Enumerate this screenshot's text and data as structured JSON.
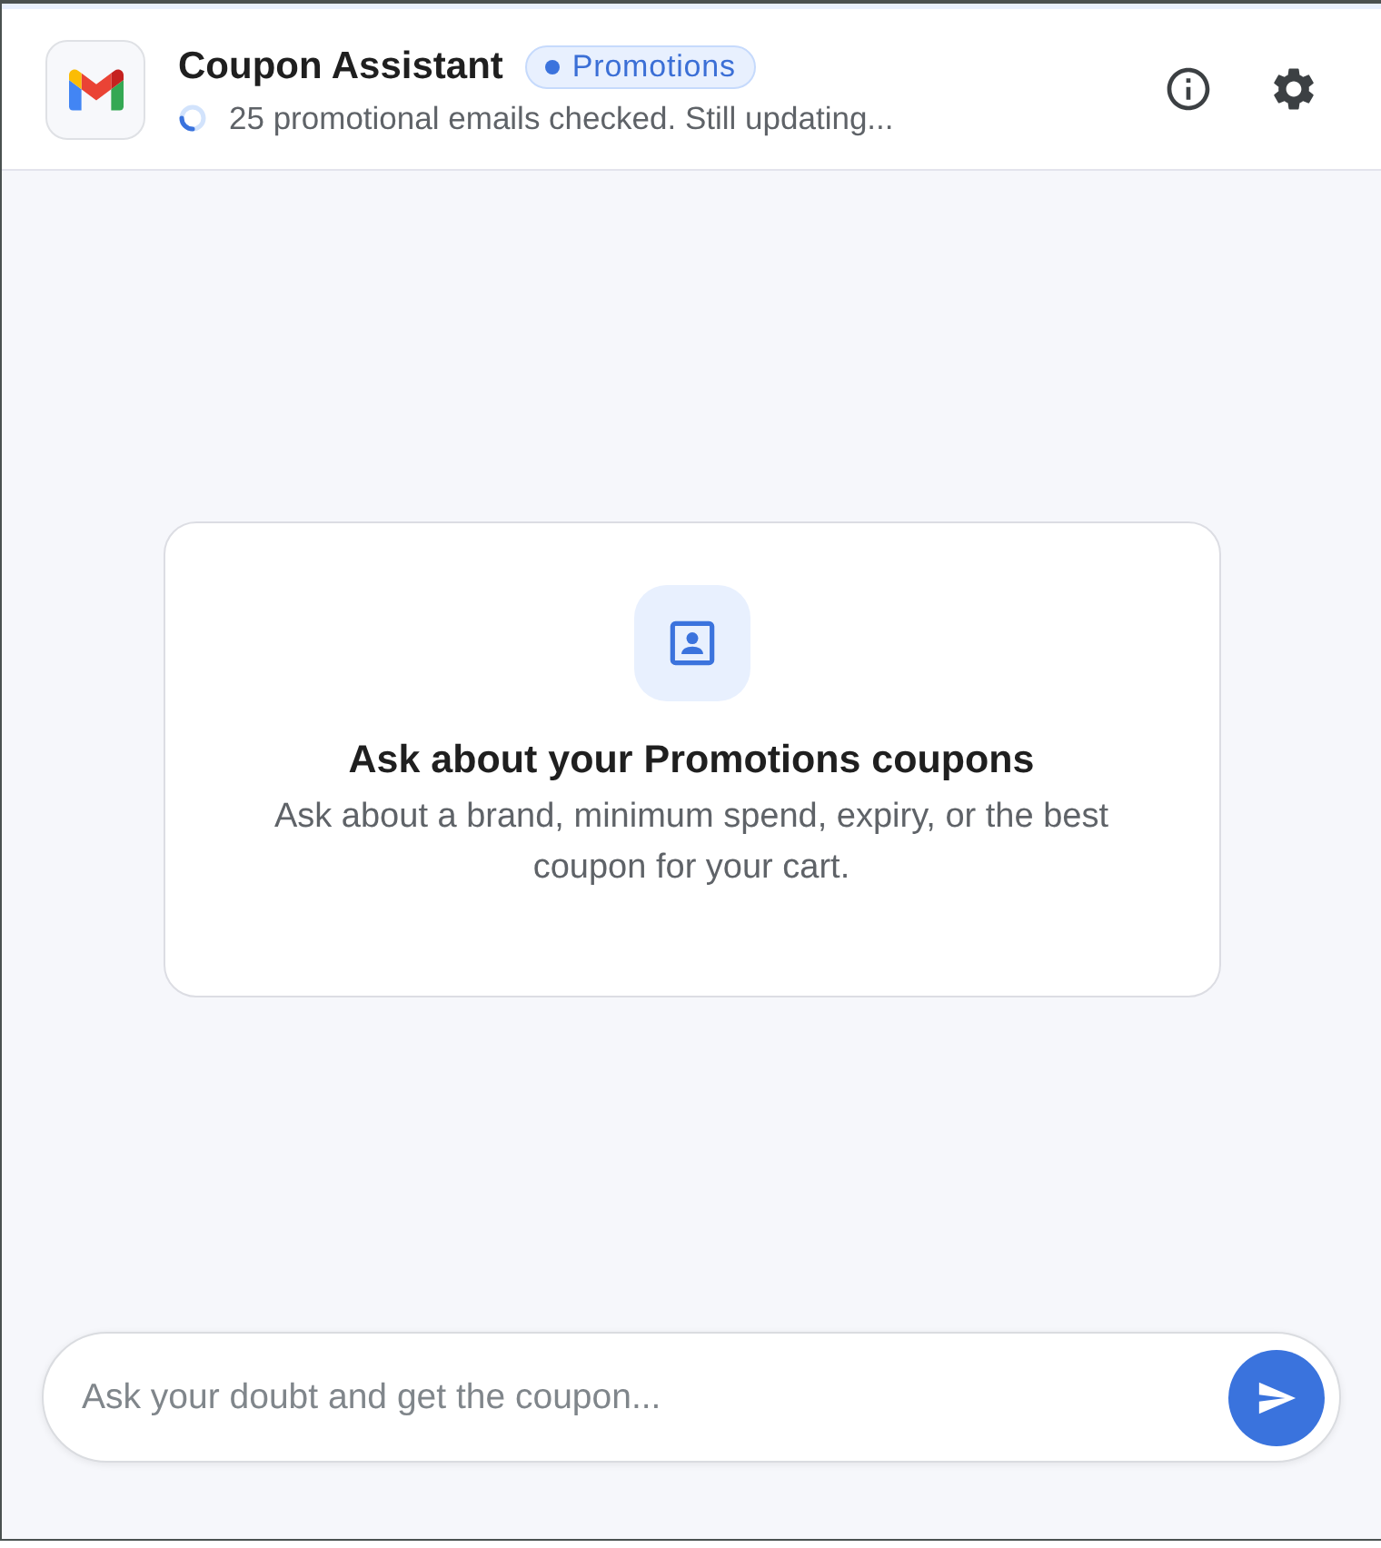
{
  "header": {
    "title": "Coupon Assistant",
    "badge": "Promotions",
    "status": {
      "loading": true,
      "text": "25 promotional emails checked. Still updating..."
    }
  },
  "empty_state": {
    "title": "Ask about your Promotions coupons",
    "description": "Ask about a brand, minimum spend, expiry, or the best coupon for your cart."
  },
  "composer": {
    "placeholder": "Ask your doubt and get the coupon..."
  }
}
